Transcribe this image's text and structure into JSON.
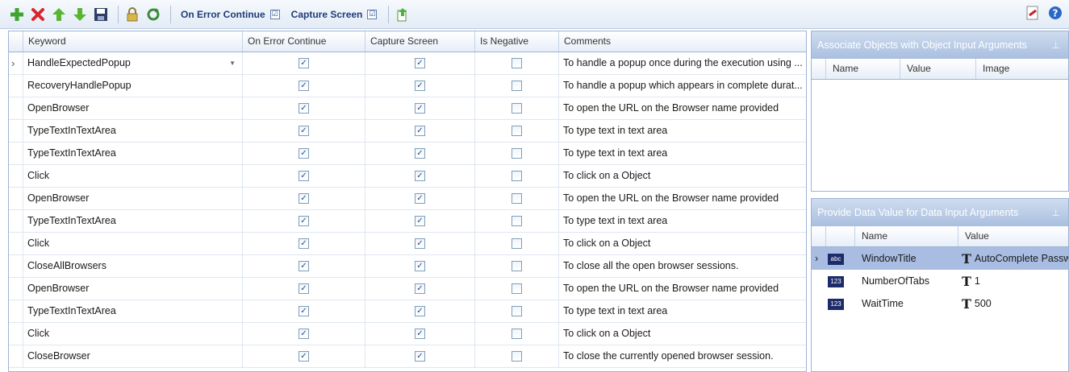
{
  "toolbar": {
    "on_error_label": "On Error Continue",
    "on_error_checked": "☑",
    "capture_label": "Capture Screen",
    "capture_checked": "☑",
    "icons": [
      "add-icon",
      "delete-icon",
      "move-up-icon",
      "move-down-icon",
      "save-icon",
      "lock-icon",
      "refresh-icon",
      "export-icon",
      "pdf-icon",
      "help-icon"
    ]
  },
  "grid": {
    "columns": [
      "Keyword",
      "On Error Continue",
      "Capture Screen",
      "Is Negative",
      "Comments"
    ],
    "rows": [
      {
        "indicator": "›",
        "keyword": "HandleExpectedPopup",
        "oec": "✓",
        "cap": "✓",
        "neg": "",
        "comment": "To handle a popup once during the execution using ..."
      },
      {
        "indicator": "",
        "keyword": "RecoveryHandlePopup",
        "oec": "✓",
        "cap": "✓",
        "neg": "",
        "comment": "To handle a popup which appears in complete durat..."
      },
      {
        "indicator": "",
        "keyword": "OpenBrowser",
        "oec": "✓",
        "cap": "✓",
        "neg": "",
        "comment": "To open the URL on the Browser name provided"
      },
      {
        "indicator": "",
        "keyword": "TypeTextInTextArea",
        "oec": "✓",
        "cap": "✓",
        "neg": "",
        "comment": "To type text in text area"
      },
      {
        "indicator": "",
        "keyword": "TypeTextInTextArea",
        "oec": "✓",
        "cap": "✓",
        "neg": "",
        "comment": "To type text in text area"
      },
      {
        "indicator": "",
        "keyword": "Click",
        "oec": "✓",
        "cap": "✓",
        "neg": "",
        "comment": "To click on a Object"
      },
      {
        "indicator": "",
        "keyword": "OpenBrowser",
        "oec": "✓",
        "cap": "✓",
        "neg": "",
        "comment": "To open the URL on the Browser name provided"
      },
      {
        "indicator": "",
        "keyword": "TypeTextInTextArea",
        "oec": "✓",
        "cap": "✓",
        "neg": "",
        "comment": "To type text in text area"
      },
      {
        "indicator": "",
        "keyword": "Click",
        "oec": "✓",
        "cap": "✓",
        "neg": "",
        "comment": "To click on a Object"
      },
      {
        "indicator": "",
        "keyword": "CloseAllBrowsers",
        "oec": "✓",
        "cap": "✓",
        "neg": "",
        "comment": "To close all the open browser sessions."
      },
      {
        "indicator": "",
        "keyword": "OpenBrowser",
        "oec": "✓",
        "cap": "✓",
        "neg": "",
        "comment": "To open the URL on the Browser name provided"
      },
      {
        "indicator": "",
        "keyword": "TypeTextInTextArea",
        "oec": "✓",
        "cap": "✓",
        "neg": "",
        "comment": "To type text in text area"
      },
      {
        "indicator": "",
        "keyword": "Click",
        "oec": "✓",
        "cap": "✓",
        "neg": "",
        "comment": "To click on a Object"
      },
      {
        "indicator": "",
        "keyword": "CloseBrowser",
        "oec": "✓",
        "cap": "✓",
        "neg": "",
        "comment": "To close the currently opened browser session."
      }
    ]
  },
  "objects_panel": {
    "title": "Associate Objects with Object Input Arguments",
    "columns": [
      "Name",
      "Value",
      "Image"
    ]
  },
  "data_panel": {
    "title": "Provide Data Value for Data Input Arguments",
    "columns": [
      "Name",
      "Value"
    ],
    "rows": [
      {
        "indicator": "›",
        "type": "abc",
        "name": "WindowTitle",
        "value_icon": "T",
        "value": "AutoComplete Passw"
      },
      {
        "indicator": "",
        "type": "123",
        "name": "NumberOfTabs",
        "value_icon": "T",
        "value": "1"
      },
      {
        "indicator": "",
        "type": "123",
        "name": "WaitTime",
        "value_icon": "T",
        "value": "500"
      }
    ]
  },
  "colors": {
    "panel_title": "#a9bfdf",
    "selected_row": "#a9bde3",
    "type_badge": "#1d2b6a"
  }
}
